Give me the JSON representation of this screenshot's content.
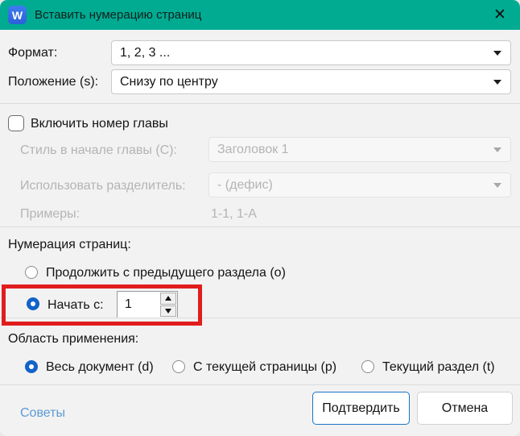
{
  "window": {
    "title": "Вставить нумерацию страниц",
    "app_icon_letter": "W",
    "close_glyph": "✕"
  },
  "colors": {
    "titlebar_teal": "#00AB92",
    "accent_blue": "#1262C8",
    "annotation_red": "#E11D1D",
    "link_blue": "#5B9BD5",
    "primary_button_border": "#1A73C4"
  },
  "format_row": {
    "label": "Формат:",
    "value": "1, 2, 3 ..."
  },
  "position_row": {
    "label": "Положение (s):",
    "value": "Снизу по центру"
  },
  "chapter": {
    "checkbox_label": "Включить номер главы",
    "checked": false,
    "style_row": {
      "label": "Стиль в начале главы (C):",
      "value": "Заголовок 1"
    },
    "separator_row": {
      "label": "Использовать разделитель:",
      "value": "- (дефис)"
    },
    "examples_row": {
      "label": "Примеры:",
      "value": "1-1, 1-A"
    }
  },
  "numbering": {
    "section_label": "Нумерация страниц:",
    "continue_option": "Продолжить с предыдущего раздела (o)",
    "start_option": "Начать с:",
    "start_value": "1",
    "selected_option": "start"
  },
  "scope": {
    "section_label": "Область применения:",
    "options": [
      "Весь документ (d)",
      "С текущей страницы (p)",
      "Текущий раздел (t)"
    ],
    "selected_option": "Весь документ (d)"
  },
  "footer": {
    "tips_link": "Советы",
    "confirm_button": "Подтвердить",
    "cancel_button": "Отмена"
  }
}
